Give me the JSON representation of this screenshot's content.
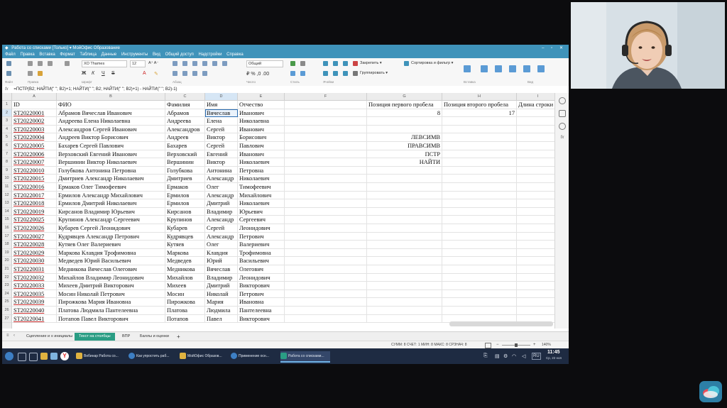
{
  "window": {
    "title": "Работа со списками [Только] ▾ МойОфис Образование",
    "menu": [
      "Файл",
      "Правка",
      "Вставка",
      "Формат",
      "Таблица",
      "Данные",
      "Инструменты",
      "Вид",
      "Общий доступ",
      "Надстройки",
      "Справка"
    ]
  },
  "ribbon": {
    "font_name": "XO Thames",
    "font_size": "12",
    "number_format": "Общий",
    "pin_label": "Закрепить ▾",
    "group_label": "Группировать ▾",
    "sort_label": "Сортировка и фильтр ▾",
    "groups": [
      "Файл",
      "Правка",
      "Шрифт",
      "Абзац",
      "Число",
      "Ячейки",
      "Стиль",
      "Вставка",
      "Вид"
    ]
  },
  "formula_bar": {
    "fx": "fx",
    "formula": "=ПСТР(B2; НАЙТИ(\" \"; B2)+1; НАЙТИ(\" \"; B2; НАЙТИ(\" \"; B2)+1) - НАЙТИ(\" \"; B2)-1)"
  },
  "grid": {
    "columns": [
      "A",
      "B",
      "C",
      "D",
      "E",
      "F",
      "G",
      "H",
      "I"
    ],
    "headers": [
      "ID",
      "ФИО",
      "Фамилия",
      "Имя",
      "Отчество",
      "",
      "Позиция первого пробела",
      "Позиция второго пробела",
      "Длина строки"
    ],
    "rows": [
      [
        "ST20220001",
        "Абрамов Вячеслав Иванович",
        "Абрамов",
        "Вячеслав",
        "Иванович",
        "",
        "8",
        "17",
        ""
      ],
      [
        "ST20220002",
        "Андреева Елена Николаевна",
        "Андреева",
        "Елена",
        "Николаевна",
        "",
        "",
        "",
        ""
      ],
      [
        "ST20220003",
        "Александров Сергей Иванович",
        "Александров",
        "Сергей",
        "Иванович",
        "",
        "",
        "",
        ""
      ],
      [
        "ST20220004",
        "Андреев Виктор Борисович",
        "Андреев",
        "Виктор",
        "Борисович",
        "",
        "ЛЕВСИМВ",
        "",
        ""
      ],
      [
        "ST20220005",
        "Бахарев Сергей Павлович",
        "Бахарев",
        "Сергей",
        "Павлович",
        "",
        "ПРАВСИМВ",
        "",
        ""
      ],
      [
        "ST20220006",
        "Верховский Евгений Иванович",
        "Верховский",
        "Евгений",
        "Иванович",
        "",
        "ПСТР",
        "",
        ""
      ],
      [
        "ST20220007",
        "Вершинин Виктор Николаевич",
        "Вершинин",
        "Виктор",
        "Николаевич",
        "",
        "НАЙТИ",
        "",
        ""
      ],
      [
        "ST20220010",
        "Голубкова Антонина Петровна",
        "Голубкова",
        "Антонина",
        "Петровна",
        "",
        "",
        "",
        ""
      ],
      [
        "ST20220015",
        "Дмитриев Александр Николаевич",
        "Дмитриев",
        "Александр",
        "Николаевич",
        "",
        "",
        "",
        ""
      ],
      [
        "ST20220016",
        "Ермаков Олег Тимофеевич",
        "Ермаков",
        "Олег",
        "Тимофеевич",
        "",
        "",
        "",
        ""
      ],
      [
        "ST20220017",
        "Ермилов Александр Михайлович",
        "Ермилов",
        "Александр",
        "Михайлович",
        "",
        "",
        "",
        ""
      ],
      [
        "ST20220018",
        "Ермилов Дмитрий Николаевич",
        "Ермилов",
        "Дмитрий",
        "Николаевич",
        "",
        "",
        "",
        ""
      ],
      [
        "ST20220019",
        "Кирсанов Владимир Юрьевич",
        "Кирсанов",
        "Владимир",
        "Юрьевич",
        "",
        "",
        "",
        ""
      ],
      [
        "ST20220025",
        "Крупинов Александр Сергеевич",
        "Крупинов",
        "Александр",
        "Сергеевич",
        "",
        "",
        "",
        ""
      ],
      [
        "ST20220026",
        "Кубарев Сергей Леонидович",
        "Кубарев",
        "Сергей",
        "Леонидович",
        "",
        "",
        "",
        ""
      ],
      [
        "ST20220027",
        "Кудрявцев Александр Петрович",
        "Кудрявцев",
        "Александр",
        "Петрович",
        "",
        "",
        "",
        ""
      ],
      [
        "ST20220028",
        "Кутяев Олег Валериевич",
        "Кутяев",
        "Олег",
        "Валериевич",
        "",
        "",
        "",
        ""
      ],
      [
        "ST20220029",
        "Маркова Клавдия Трофимовна",
        "Маркова",
        "Клавдия",
        "Трофимовна",
        "",
        "",
        "",
        ""
      ],
      [
        "ST20220030",
        "Медведев Юрий Васильевич",
        "Медведев",
        "Юрий",
        "Васильевич",
        "",
        "",
        "",
        ""
      ],
      [
        "ST20220031",
        "Медникова Вячеслав Олегович",
        "Медникова",
        "Вячеслав",
        "Олегович",
        "",
        "",
        "",
        ""
      ],
      [
        "ST20220032",
        "Михайлов Владимир Леонидович",
        "Михайлов",
        "Владимир",
        "Леонидович",
        "",
        "",
        "",
        ""
      ],
      [
        "ST20220033",
        "Михеев Дмитрий Викторович",
        "Михеев",
        "Дмитрий",
        "Викторович",
        "",
        "",
        "",
        ""
      ],
      [
        "ST20220035",
        "Мосин Николай Петрович",
        "Мосин",
        "Николай",
        "Петрович",
        "",
        "",
        "",
        ""
      ],
      [
        "ST20220039",
        "Пирожкова Мария Ивановна",
        "Пирожкова",
        "Мария",
        "Ивановна",
        "",
        "",
        "",
        ""
      ],
      [
        "ST20220040",
        "Платова Людмила Пантелеевна",
        "Платова",
        "Людмила",
        "Пантелеевна",
        "",
        "",
        "",
        ""
      ],
      [
        "ST20220041",
        "Потапов Павел Викторович",
        "Потапов",
        "Павел",
        "Викторович",
        "",
        "",
        "",
        ""
      ]
    ]
  },
  "sheet_tabs": [
    "Сцепление и ≡ инициалы",
    "Текст на столбцы",
    "ВПР",
    "Баллы и оценки"
  ],
  "active_tab_index": 1,
  "add_tab": "+",
  "statusbar": {
    "stats": "СУММ: 8  СЧЕТ: 1  МИН: 8  МАКС: 8  СРЗНАЧ: 8",
    "zoom": "140%"
  },
  "taskbar": {
    "items": [
      "Вебинар Работа со...",
      "Как упростить раб...",
      "МойОфис Образов...",
      "Применение осн...",
      "Работа со списками..."
    ],
    "time": "11:45",
    "date": "Ср, 22 ноя",
    "lang": "RU"
  },
  "colors": {
    "accent": "#3f93ba",
    "active_tab": "#2a9d84",
    "taskbar": "#1e2b42"
  }
}
